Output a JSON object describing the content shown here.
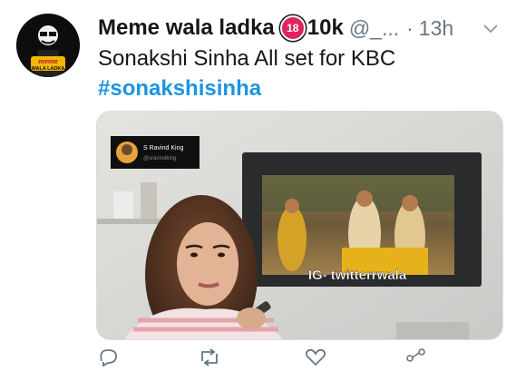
{
  "tweet": {
    "author_name": "Meme wala ladka",
    "badge_label": "18",
    "badge_count": "10k",
    "handle": "@_...",
    "separator": "·",
    "time": "13h",
    "text": "Sonakshi Sinha All set for KBC",
    "hashtag": "#sonakshisinha"
  },
  "avatar": {
    "logo_text_line1": "meme",
    "logo_text_line2": "WALA LADKA"
  },
  "media": {
    "inset_name": "S Ravind King",
    "inset_handle": "@sravindking",
    "watermark": "IG- twitterrwala"
  },
  "icons": {
    "caret": "chevron-down-icon",
    "reply": "reply-icon",
    "retweet": "retweet-icon",
    "like": "heart-icon",
    "share": "share-icon"
  },
  "colors": {
    "link": "#1b95e0",
    "badge": "#e0245e",
    "muted": "#657786"
  }
}
